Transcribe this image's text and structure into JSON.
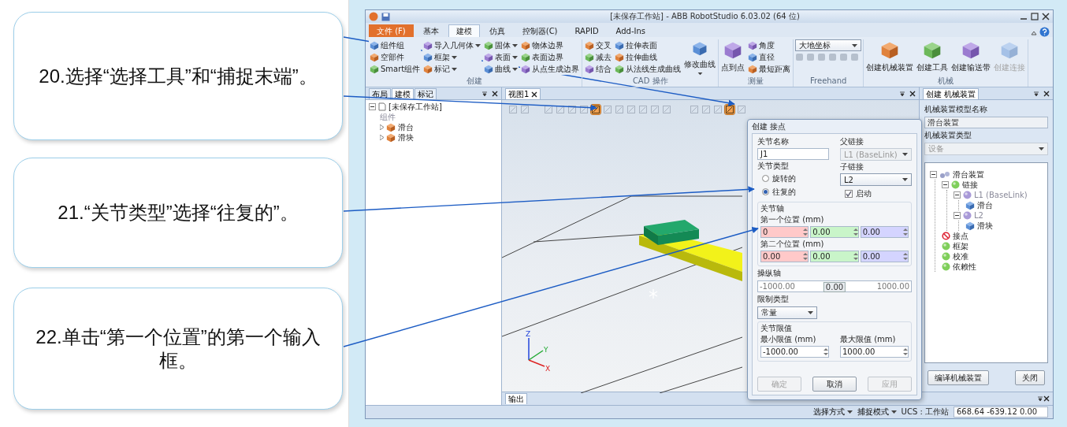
{
  "callouts": [
    {
      "text": "20.选择“选择工具”和“捕捉末端”。"
    },
    {
      "text": "21.“关节类型”选择“往复的”。"
    },
    {
      "text": "22.单击“第一个位置”的第一个输入框。"
    }
  ],
  "window": {
    "title": "[未保存工作站] - ABB RobotStudio 6.03.02 (64 位)"
  },
  "menu_tabs": [
    {
      "label": "文件 (F)",
      "kind": "file",
      "selected": false
    },
    {
      "label": "基本",
      "kind": "tab",
      "selected": false
    },
    {
      "label": "建模",
      "kind": "tab",
      "selected": true
    },
    {
      "label": "仿真",
      "kind": "tab",
      "selected": false
    },
    {
      "label": "控制器(C)",
      "kind": "tab",
      "selected": false
    },
    {
      "label": "RAPID",
      "kind": "tab",
      "selected": false
    },
    {
      "label": "Add-Ins",
      "kind": "tab",
      "selected": false
    }
  ],
  "ribbon": [
    {
      "title": "创建",
      "items": [
        {
          "label": "组件组",
          "kind": "small"
        },
        {
          "label": "空部件",
          "kind": "small"
        },
        {
          "label": "Smart组件",
          "kind": "small"
        },
        {
          "label": "导入几何体",
          "kind": "menu"
        },
        {
          "label": "框架",
          "kind": "menu"
        },
        {
          "label": "标记",
          "kind": "menu"
        },
        {
          "label": "固体",
          "kind": "menu"
        },
        {
          "label": "表面",
          "kind": "menu"
        },
        {
          "label": "曲线",
          "kind": "menu"
        },
        {
          "label": "物体边界",
          "kind": "small"
        },
        {
          "label": "表面边界",
          "kind": "small"
        },
        {
          "label": "从点生成边界",
          "kind": "small"
        }
      ]
    },
    {
      "title": "CAD 操作",
      "items": [
        {
          "label": "交叉",
          "kind": "small"
        },
        {
          "label": "减去",
          "kind": "small"
        },
        {
          "label": "结合",
          "kind": "small"
        },
        {
          "label": "拉伸表面",
          "kind": "small"
        },
        {
          "label": "拉伸曲线",
          "kind": "small"
        },
        {
          "label": "从法线生成曲线",
          "kind": "small"
        },
        {
          "label": "修改曲线",
          "kind": "split"
        }
      ]
    },
    {
      "title": "测量",
      "items": [
        {
          "label": "点到点",
          "kind": "large"
        },
        {
          "label": "角度",
          "kind": "small"
        },
        {
          "label": "直径",
          "kind": "small"
        },
        {
          "label": "最短距离",
          "kind": "small"
        }
      ]
    },
    {
      "title": "Freehand",
      "items": [
        {
          "label": "大地坐标",
          "kind": "dropdown"
        },
        {
          "kind": "icons"
        }
      ]
    },
    {
      "title": "机械",
      "items": [
        {
          "label": "创建机械装置",
          "kind": "large",
          "disabled": false
        },
        {
          "label": "创建工具",
          "kind": "large",
          "disabled": false
        },
        {
          "label": "创建输送带",
          "kind": "large",
          "disabled": false
        },
        {
          "label": "创建连接",
          "kind": "large",
          "disabled": true
        }
      ]
    }
  ],
  "left_panel": {
    "tabs": [
      {
        "label": "布局",
        "selected": false
      },
      {
        "label": "建模",
        "selected": true
      },
      {
        "label": "标记",
        "selected": false
      }
    ],
    "tree": [
      {
        "label": "[未保存工作站]",
        "kind": "station",
        "children": [
          {
            "label": "组件",
            "kind": "heading"
          },
          {
            "label": "滑台",
            "kind": "part"
          },
          {
            "label": "滑块",
            "kind": "part"
          }
        ]
      }
    ]
  },
  "viewport": {
    "tab": "视图1",
    "tools": [
      {
        "selected": false
      },
      {
        "selected": false
      },
      {
        "selected": false
      },
      {
        "selected": false
      },
      {
        "selected": false
      },
      {
        "selected": false
      },
      {
        "selected": true
      },
      {
        "selected": false
      },
      {
        "selected": false
      },
      {
        "selected": false
      },
      {
        "selected": false
      },
      {
        "selected": false
      },
      {
        "selected": false
      },
      {
        "selected": false
      },
      {
        "selected": false
      },
      {
        "selected": false
      },
      {
        "selected": true
      },
      {
        "selected": false
      }
    ],
    "axes": [
      "X",
      "Y",
      "Z"
    ]
  },
  "joint_dialog": {
    "title": "创建 接点",
    "joint_name": {
      "label": "关节名称",
      "value": "J1"
    },
    "parent_link": {
      "label": "父链接",
      "value": "L1 (BaseLink)",
      "disabled": true
    },
    "joint_type": {
      "label": "关节类型",
      "options": [
        {
          "label": "旋转的",
          "selected": false
        },
        {
          "label": "往复的",
          "selected": true
        }
      ]
    },
    "child_link": {
      "label": "子链接",
      "value": "L2",
      "disabled": false
    },
    "enabled": {
      "label": "启动",
      "checked": true
    },
    "joint_axis": {
      "label": "关节轴",
      "positions": [
        {
          "label": "第一个位置 (mm)",
          "values": [
            {
              "value": "0",
              "color": "#ffc9c9"
            },
            {
              "value": "0.00",
              "color": "#c9f5c9"
            },
            {
              "value": "0.00",
              "color": "#d4d4ff"
            }
          ]
        },
        {
          "label": "第二个位置 (mm)",
          "values": [
            {
              "value": "0.00",
              "color": "#ffc9c9"
            },
            {
              "value": "0.00",
              "color": "#c9f5c9"
            },
            {
              "value": "0.00",
              "color": "#d4d4ff"
            }
          ]
        }
      ]
    },
    "jog_axis": {
      "label": "操纵轴",
      "min": "-1000.00",
      "value": "0.00",
      "max": "1000.00",
      "level": 0.5
    },
    "limit_type": {
      "label": "限制类型",
      "value": "常量"
    },
    "joint_limits": {
      "label": "关节限值",
      "min": {
        "label": "最小限值 (mm)",
        "value": "-1000.00"
      },
      "max": {
        "label": "最大限值 (mm)",
        "value": "1000.00"
      }
    },
    "buttons": [
      {
        "label": "确定",
        "disabled": true
      },
      {
        "label": "取消",
        "disabled": false
      },
      {
        "label": "应用",
        "disabled": true
      }
    ]
  },
  "mechanism_panel": {
    "tab": "创建 机械装置",
    "model_name": {
      "label": "机械装置模型名称",
      "value": "滑台装置"
    },
    "type": {
      "label": "机械装置类型",
      "value": "设备"
    },
    "tree": [
      {
        "label": "滑台装置",
        "kind": "mechanism",
        "children": [
          {
            "label": "链接",
            "kind": "folder",
            "children": [
              {
                "label": "L1 (BaseLink)",
                "kind": "link",
                "children": [
                  {
                    "label": "滑台",
                    "kind": "part"
                  }
                ]
              },
              {
                "label": "L2",
                "kind": "link",
                "children": [
                  {
                    "label": "滑块",
                    "kind": "part"
                  }
                ]
              }
            ]
          },
          {
            "label": "接点",
            "kind": "error"
          },
          {
            "label": "框架",
            "kind": "folder"
          },
          {
            "label": "校准",
            "kind": "folder"
          },
          {
            "label": "依赖性",
            "kind": "folder"
          }
        ]
      }
    ],
    "buttons": [
      {
        "label": "编译机械装置"
      },
      {
        "label": "关闭"
      }
    ]
  },
  "output": {
    "tab": "输出"
  },
  "status_bar": [
    {
      "label": "选择方式",
      "kind": "menu"
    },
    {
      "label": "捕捉模式",
      "kind": "menu"
    },
    {
      "label": "UCS : 工作站",
      "kind": "text"
    },
    {
      "label": "668.64  -639.12  0.00",
      "kind": "field"
    }
  ]
}
